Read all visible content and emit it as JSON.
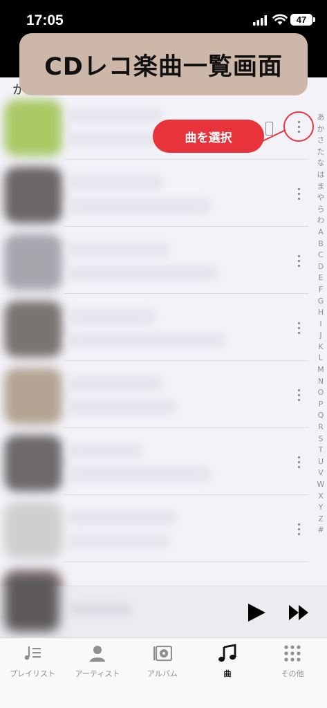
{
  "status_bar": {
    "time": "17:05",
    "battery": "47",
    "icons": [
      "signal-icon",
      "wifi-icon",
      "battery-icon"
    ]
  },
  "overlay_title": "CDレコ楽曲一覧画面",
  "list": {
    "section_header": "か"
  },
  "annotation": {
    "label": "曲を選択",
    "color": "#e8333a"
  },
  "index_letters": [
    "あ",
    "か",
    "さ",
    "た",
    "な",
    "は",
    "ま",
    "や",
    "ら",
    "わ",
    "A",
    "B",
    "C",
    "D",
    "E",
    "F",
    "G",
    "H",
    "I",
    "J",
    "K",
    "L",
    "M",
    "N",
    "O",
    "P",
    "Q",
    "R",
    "S",
    "T",
    "U",
    "V",
    "W",
    "X",
    "Y",
    "Z",
    "#"
  ],
  "player": {
    "icons": [
      "play-icon",
      "fast-forward-icon"
    ]
  },
  "tabs": [
    {
      "label": "プレイリスト",
      "icon": "playlist-icon",
      "active": false
    },
    {
      "label": "アーティスト",
      "icon": "artist-icon",
      "active": false
    },
    {
      "label": "アルバム",
      "icon": "album-icon",
      "active": false
    },
    {
      "label": "曲",
      "icon": "music-note-icon",
      "active": true
    },
    {
      "label": "その他",
      "icon": "grid-icon",
      "active": false
    }
  ],
  "colors": {
    "accent": "#e8333a",
    "banner": "#cdb7a9",
    "background": "#f3f2f8"
  }
}
